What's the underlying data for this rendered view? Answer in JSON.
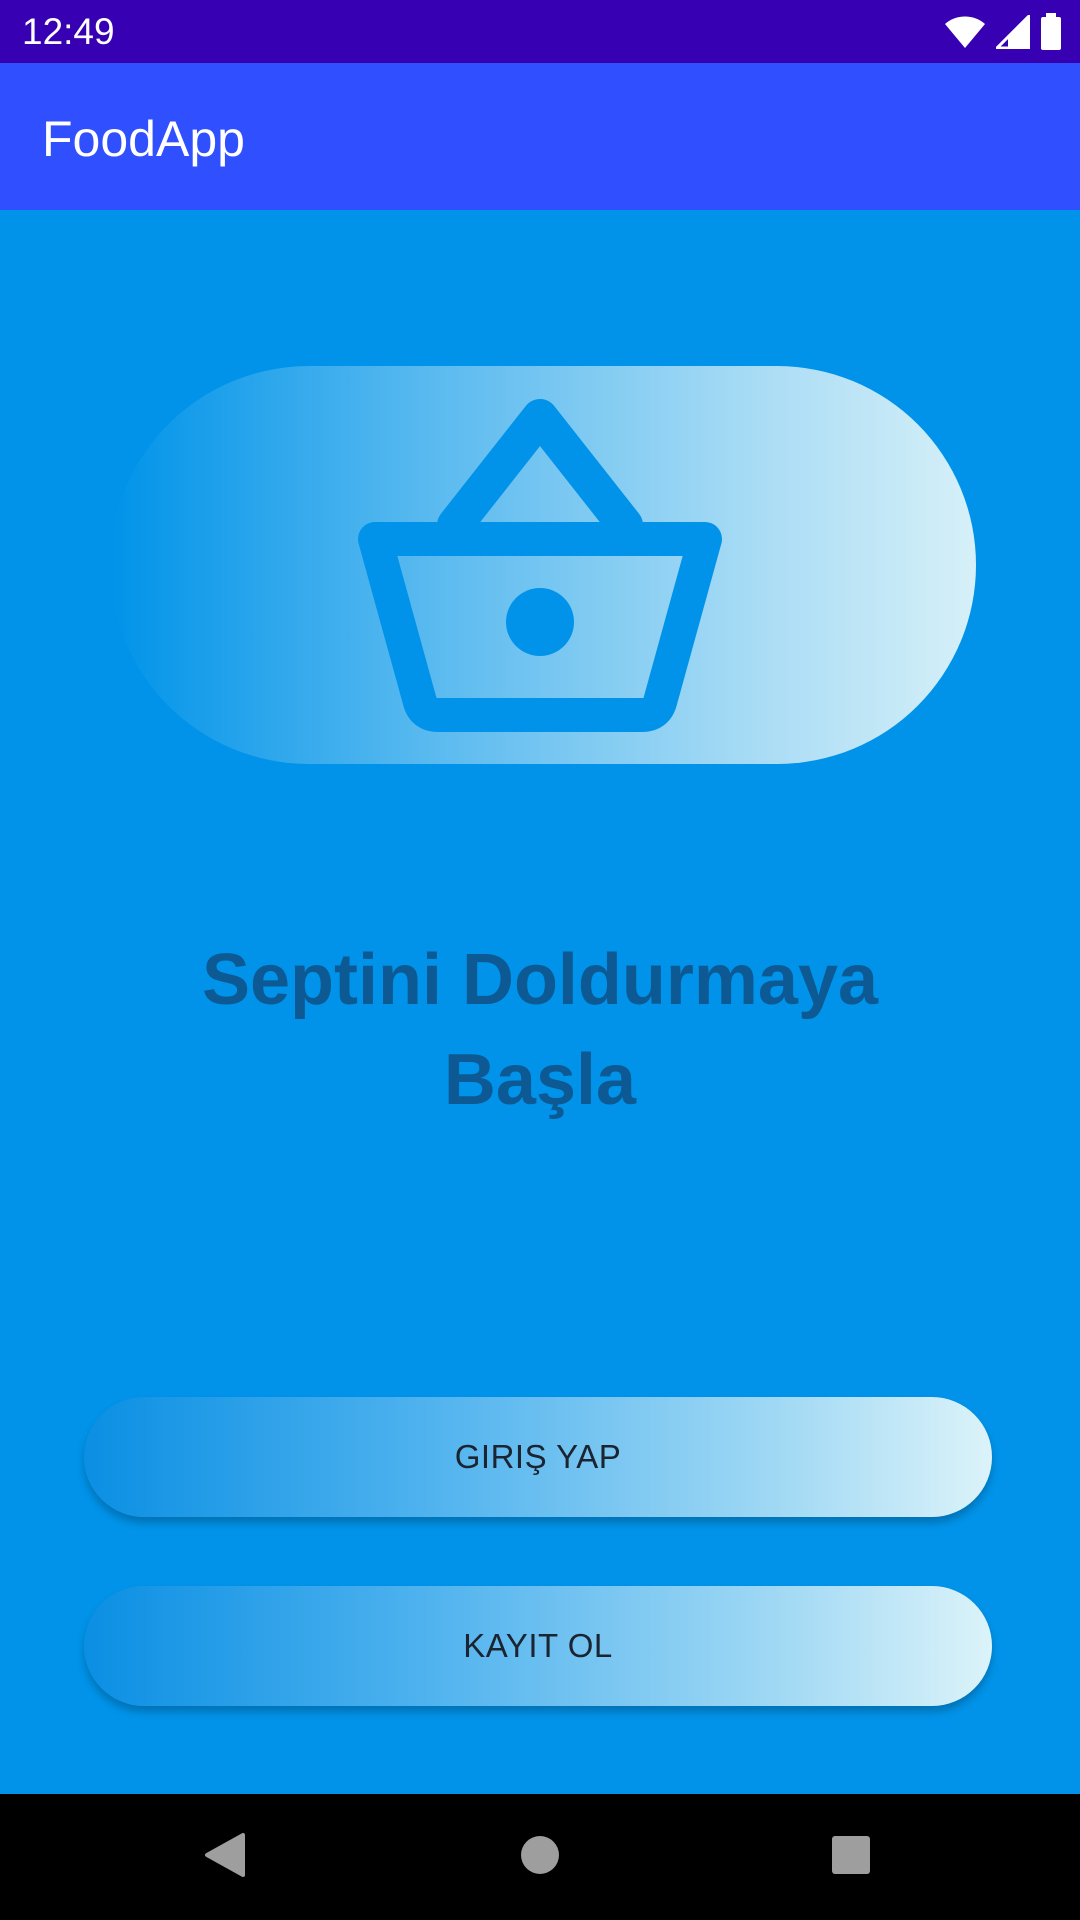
{
  "status_bar": {
    "time": "12:49",
    "icons": [
      "wifi-icon",
      "cellular-signal-icon",
      "battery-icon"
    ]
  },
  "app_bar": {
    "title": "FoodApp",
    "background_color": "#304ffe"
  },
  "hero": {
    "icon": "shopping-basket-icon"
  },
  "headline": {
    "line1": "Septini Doldurmaya",
    "line2": "Başla",
    "color": "#0d5993"
  },
  "buttons": {
    "login_label": "GIRIŞ YAP",
    "register_label": "KAYIT OL"
  },
  "nav_bar": {
    "items": [
      "back-icon",
      "home-icon",
      "recents-icon"
    ]
  },
  "colors": {
    "status_bar": "#3700b3",
    "background": "#0093e9",
    "accent": "#304ffe"
  }
}
